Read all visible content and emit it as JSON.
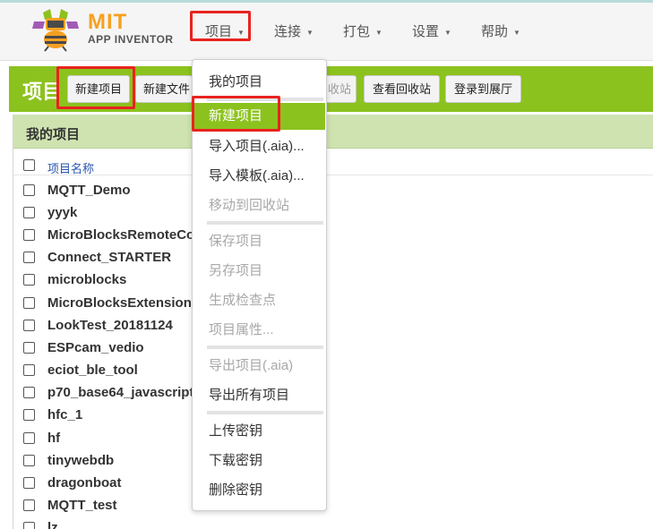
{
  "brand": {
    "title": "MIT",
    "subtitle": "APP INVENTOR"
  },
  "nav": [
    {
      "label": "项目"
    },
    {
      "label": "连接"
    },
    {
      "label": "打包"
    },
    {
      "label": "设置"
    },
    {
      "label": "帮助"
    }
  ],
  "toolbar": {
    "title": "项目",
    "new_project": "新建项目",
    "new_folder": "新建文件",
    "trash_partial": "收站",
    "view_trash": "查看回收站",
    "login_gallery": "登录到展厅"
  },
  "panel": {
    "title": "我的项目",
    "column_name": "项目名称",
    "projects": [
      "MQTT_Demo",
      "yyyk",
      "MicroBlocksRemoteCo",
      "Connect_STARTER",
      "microblocks",
      "MicroBlocksExtension",
      "LookTest_20181124",
      "ESPcam_vedio",
      "eciot_ble_tool",
      "p70_base64_javascript",
      "hfc_1",
      "hf",
      "tinywebdb",
      "dragonboat",
      "MQTT_test",
      "lz"
    ]
  },
  "menu": {
    "my_projects": "我的项目",
    "new_project": "新建项目",
    "import_project": "导入项目(.aia)...",
    "import_template": "导入模板(.aia)...",
    "move_to_trash": "移动到回收站",
    "save_project": "保存项目",
    "save_as": "另存项目",
    "checkpoint": "生成检查点",
    "properties": "项目属性...",
    "export_project": "导出项目(.aia)",
    "export_all": "导出所有项目",
    "upload_keystore": "上传密钥",
    "download_keystore": "下载密钥",
    "delete_keystore": "删除密钥"
  },
  "colors": {
    "accent_green": "#8cc21e",
    "highlight_red": "#e8231f",
    "brand_orange": "#f5a121"
  }
}
